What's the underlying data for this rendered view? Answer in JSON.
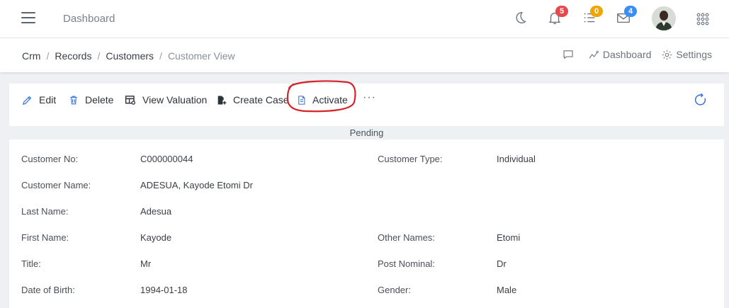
{
  "header": {
    "title": "Dashboard",
    "notifications_count": "5",
    "tasks_count": "0",
    "messages_count": "4",
    "colors": {
      "bell_badge": "#e5484d",
      "tasks_badge": "#f0a500",
      "messages_badge": "#3a8ef6"
    }
  },
  "breadcrumb": {
    "items": [
      "Crm",
      "Records",
      "Customers"
    ],
    "current": "Customer View"
  },
  "crumb_actions": {
    "dashboard": "Dashboard",
    "settings": "Settings"
  },
  "toolbar": {
    "edit": "Edit",
    "delete": "Delete",
    "view_valuation": "View Valuation",
    "create_case": "Create Case",
    "activate": "Activate",
    "more": "···",
    "accent": "#2f6fdc"
  },
  "status": "Pending",
  "fields": {
    "customer_no": {
      "label": "Customer No:",
      "value": "C000000044"
    },
    "customer_type": {
      "label": "Customer Type:",
      "value": "Individual"
    },
    "customer_name": {
      "label": "Customer Name:",
      "value": "ADESUA, Kayode Etomi Dr"
    },
    "last_name": {
      "label": "Last Name:",
      "value": "Adesua"
    },
    "first_name": {
      "label": "First Name:",
      "value": "Kayode"
    },
    "other_names": {
      "label": "Other Names:",
      "value": "Etomi"
    },
    "title": {
      "label": "Title:",
      "value": "Mr"
    },
    "post_nominal": {
      "label": "Post Nominal:",
      "value": "Dr"
    },
    "date_of_birth": {
      "label": "Date of Birth:",
      "value": "1994-01-18"
    },
    "gender": {
      "label": "Gender:",
      "value": "Male"
    }
  }
}
